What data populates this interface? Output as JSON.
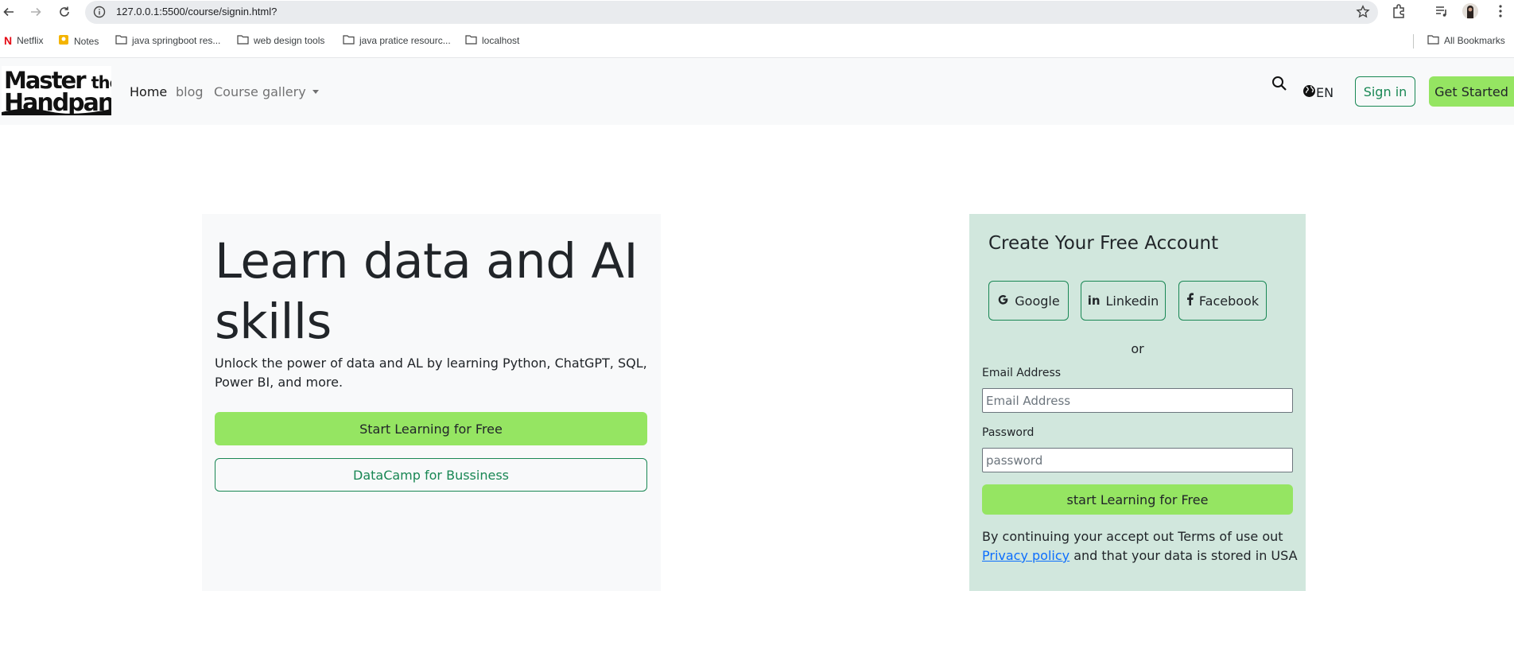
{
  "browser": {
    "url": "127.0.0.1:5500/course/signin.html?",
    "bookmarks": [
      "Netflix",
      "Notes",
      "java springboot res...",
      "web design tools",
      "java pratice resourc...",
      "localhost"
    ],
    "all_bookmarks": "All Bookmarks"
  },
  "navbar": {
    "logo_top": "Master",
    "logo_top_small": "the",
    "logo_bottom": "Handpan",
    "links": [
      "Home",
      "blog",
      "Course gallery"
    ],
    "language": "EN",
    "sign_in": "Sign in",
    "get_started": "Get Started"
  },
  "hero": {
    "title": "Learn data and AI skills",
    "lead": "Unlock the power of data and AL by learning Python, ChatGPT, SQL, Power BI, and more.",
    "primary_button": "Start Learning for Free",
    "secondary_button": "DataCamp for Bussiness"
  },
  "signup": {
    "title": "Create Your Free Account",
    "social": [
      "Google",
      "Linkedin",
      "Facebook"
    ],
    "or": "or",
    "email_label": "Email Address",
    "email_placeholder": "Email Address",
    "password_label": "Password",
    "password_placeholder": "password",
    "submit": "start Learning for Free",
    "terms_before": "By continuing your accept out Terms of use out ",
    "terms_link": "Privacy policy",
    "terms_after": " and that your data is stored in USA"
  },
  "colors": {
    "accent_green": "#95e562",
    "outline_green": "#198754",
    "card_green": "#d1e7dd",
    "link_blue": "#0d6efd"
  }
}
